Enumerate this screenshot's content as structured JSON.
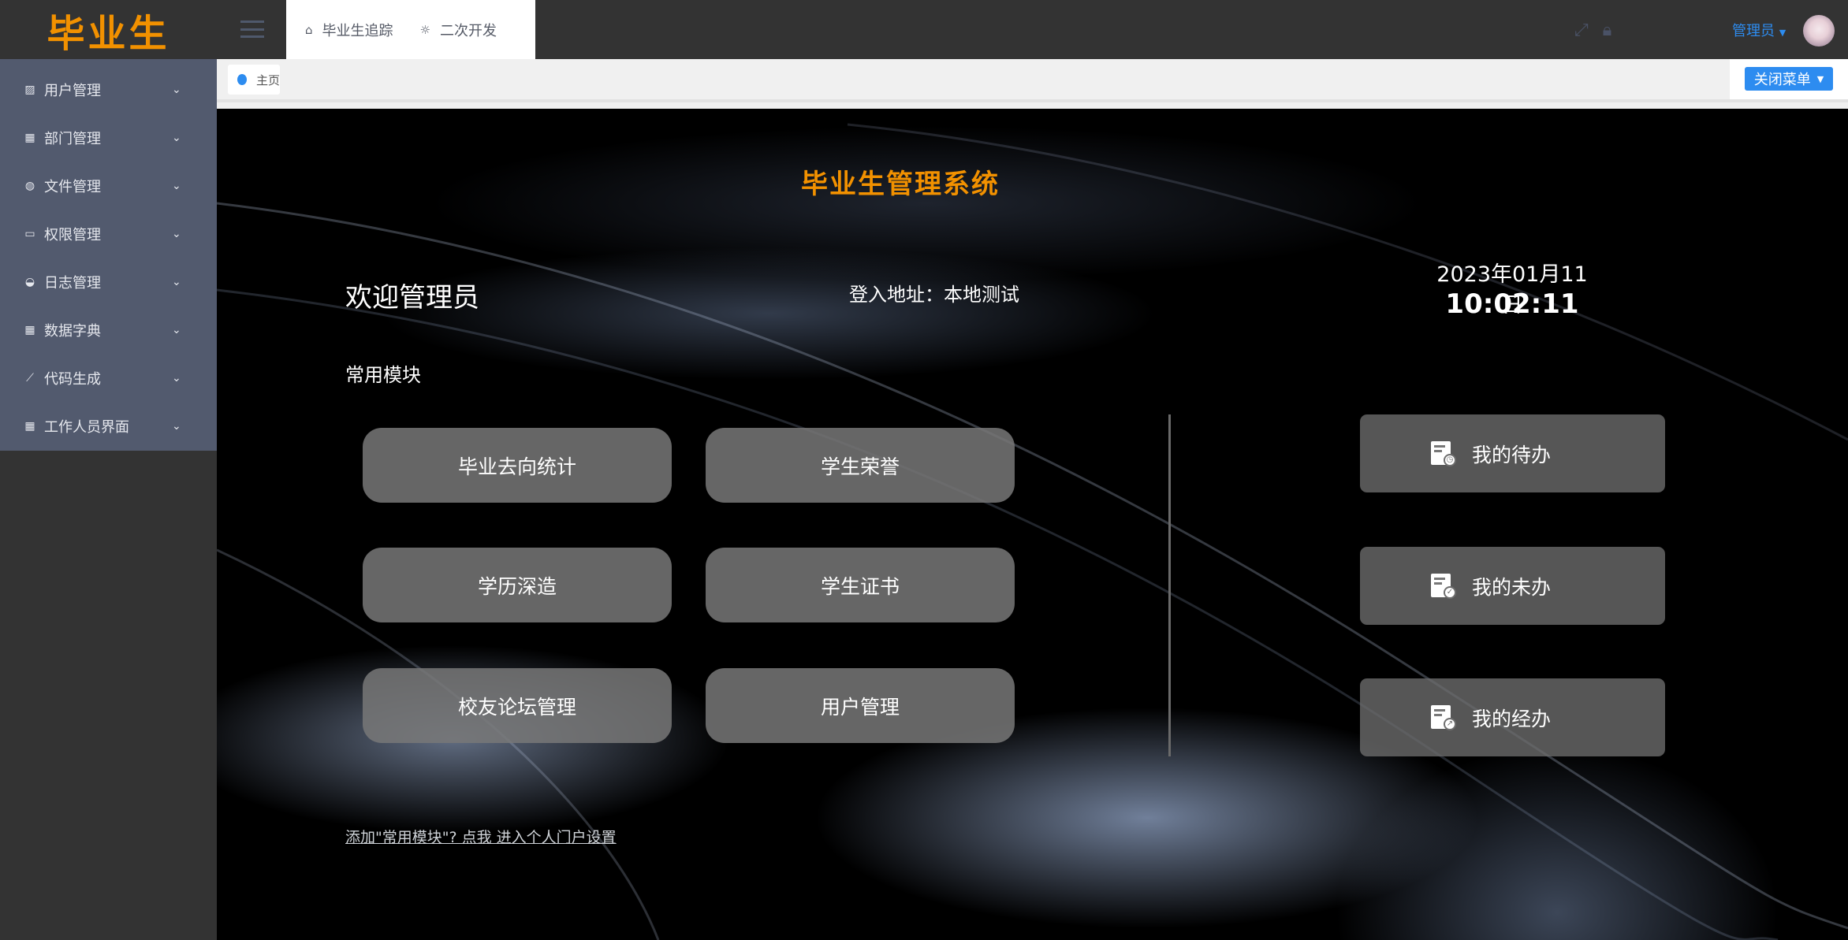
{
  "logo": "毕业生",
  "sidebar": {
    "items": [
      {
        "label": "用户管理",
        "icon": "chart-icon"
      },
      {
        "label": "部门管理",
        "icon": "grid-icon"
      },
      {
        "label": "文件管理",
        "icon": "ball-icon"
      },
      {
        "label": "权限管理",
        "icon": "monitor-icon"
      },
      {
        "label": "日志管理",
        "icon": "gauge-icon"
      },
      {
        "label": "数据字典",
        "icon": "grid-icon"
      },
      {
        "label": "代码生成",
        "icon": "brush-icon"
      },
      {
        "label": "工作人员界面",
        "icon": "grid-icon"
      }
    ]
  },
  "topbar": {
    "tabs": [
      {
        "label": "毕业生追踪",
        "icon": "home-icon"
      },
      {
        "label": "二次开发",
        "icon": "bulb-icon"
      }
    ],
    "user": "管理员"
  },
  "breadcrumb": {
    "home": "主页",
    "close_menu": "关闭菜单"
  },
  "main": {
    "title": "毕业生管理系统",
    "welcome": "欢迎管理员",
    "login_address": "登入地址：本地测试",
    "date": "2023年01月11日",
    "time": "10:02:11",
    "common_modules_label": "常用模块",
    "modules": [
      "毕业去向统计",
      "学生荣誉",
      "学历深造",
      "学生证书",
      "校友论坛管理",
      "用户管理"
    ],
    "tasks": [
      {
        "label": "我的待办",
        "badge": "◷"
      },
      {
        "label": "我的未办",
        "badge": "✓"
      },
      {
        "label": "我的经办",
        "badge": "↗"
      }
    ],
    "settings_link": "添加\"常用模块\"? 点我 进入个人门户设置"
  },
  "colors": {
    "accent": "#2d8cf0",
    "brand": "#f29100",
    "sidebar": "#525a6e"
  }
}
